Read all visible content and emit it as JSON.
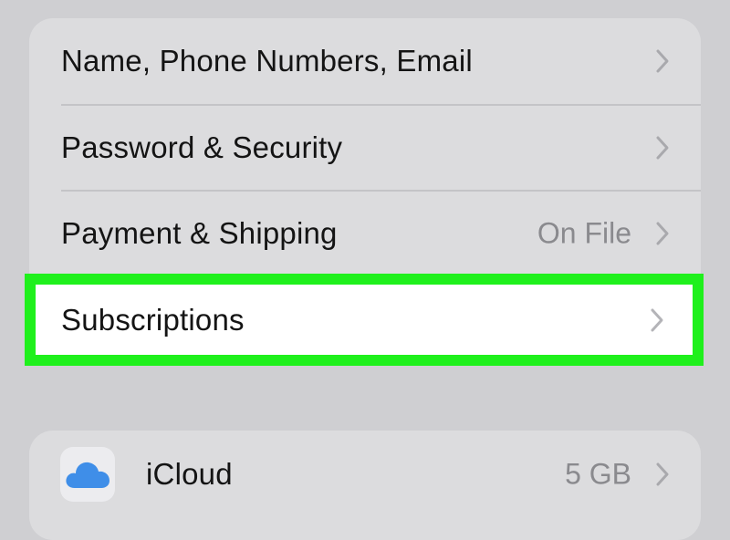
{
  "account_group": {
    "rows": [
      {
        "label": "Name, Phone Numbers, Email",
        "detail": ""
      },
      {
        "label": "Password & Security",
        "detail": ""
      },
      {
        "label": "Payment & Shipping",
        "detail": "On File"
      }
    ],
    "highlighted_row": {
      "label": "Subscriptions"
    }
  },
  "services_group": {
    "icloud": {
      "label": "iCloud",
      "detail": "5 GB",
      "icon": "icloud-icon"
    }
  },
  "colors": {
    "background": "#cfcfd2",
    "group_fill": "#dcdcde",
    "highlight_border": "#1ff01c",
    "chevron": "#a9a9ad",
    "icloud_blue": "#3f8ee8"
  }
}
